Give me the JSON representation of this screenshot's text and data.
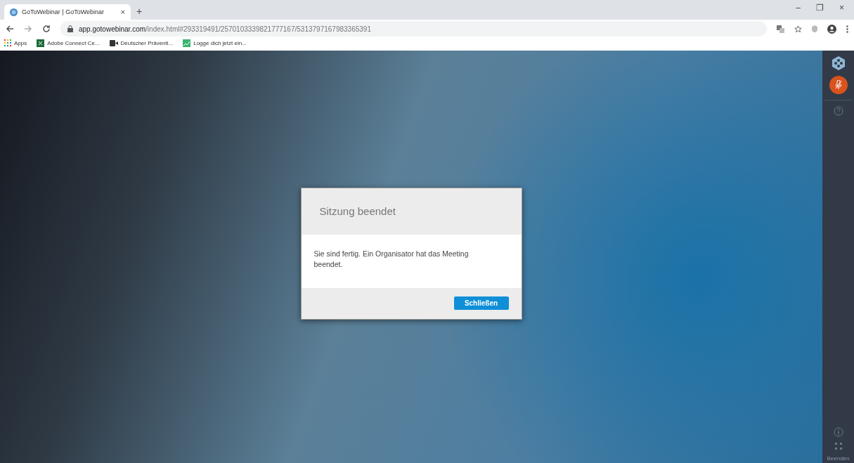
{
  "browser": {
    "tab_title": "GoToWebinar | GoToWebinar",
    "tab_close": "×",
    "new_tab": "+",
    "window_controls": [
      "–",
      "❐",
      "×"
    ],
    "url_host": "app.gotowebinar.com",
    "url_path": "/index.html#293319491/2570103339821777167/5313797167983365391",
    "bookmarks": [
      {
        "label": "Apps",
        "kind": "apps"
      },
      {
        "label": "Adobe Connect Ce...",
        "kind": "adobe"
      },
      {
        "label": "Deutscher Präventi...",
        "kind": "video"
      },
      {
        "label": "Logge dich jetzt ein...",
        "kind": "chart"
      }
    ]
  },
  "sidebar": {
    "mic_muted": true,
    "end_label": "Beenden"
  },
  "dialog": {
    "title": "Sitzung beendet",
    "message": "Sie sind fertig. Ein Organisator hat das Meeting beendet.",
    "button": "Schließen"
  }
}
